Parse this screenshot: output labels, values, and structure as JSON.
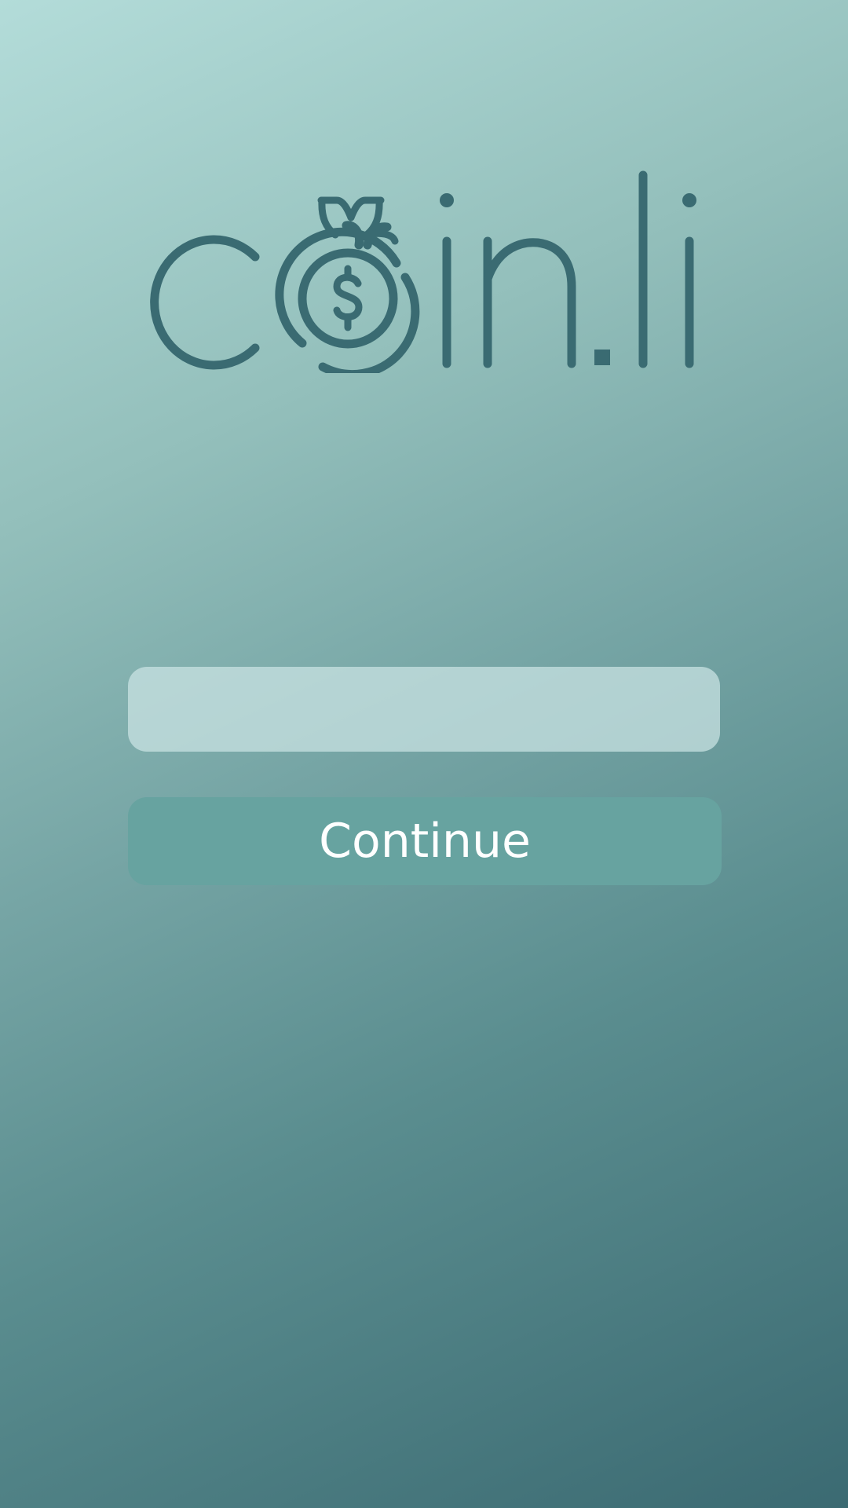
{
  "app": {
    "logo_text": "coin.li",
    "icon": "money-bag-dollar-icon"
  },
  "form": {
    "input_value": "",
    "input_placeholder": "",
    "continue_label": "Continue"
  },
  "colors": {
    "brand": "#3a6b72",
    "button": "#67a3a0",
    "button_text": "#ffffff",
    "input_background": "#cce4e4"
  }
}
